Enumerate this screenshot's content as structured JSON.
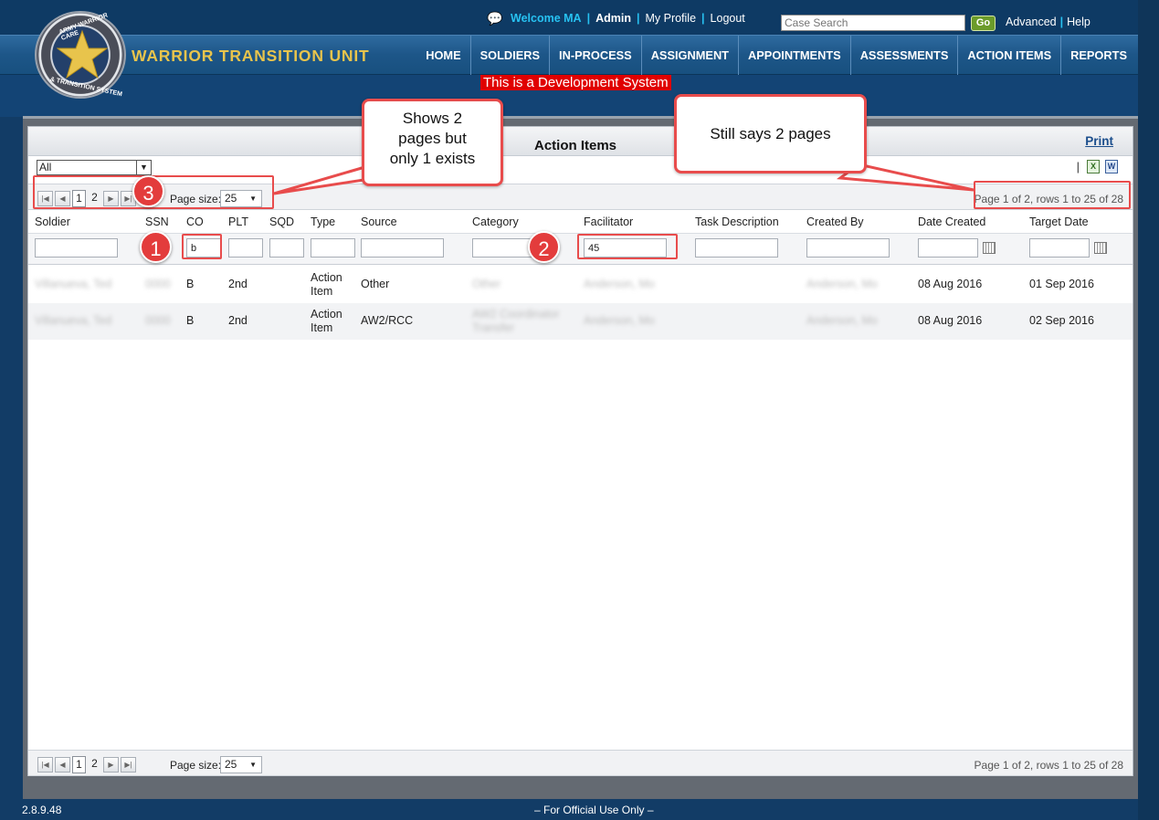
{
  "header": {
    "welcome": "Welcome MA",
    "admin": "Admin",
    "my_profile": "My Profile",
    "logout": "Logout",
    "case_search_placeholder": "Case Search",
    "go": "Go",
    "advanced": "Advanced",
    "help": "Help",
    "brand": "WARRIOR TRANSITION UNIT",
    "logo_text_top": "ARMY WARRIOR CARE",
    "logo_text_bottom": "& TRANSITION SYSTEM"
  },
  "nav": [
    "HOME",
    "SOLDIERS",
    "IN-PROCESS",
    "ASSIGNMENT",
    "APPOINTMENTS",
    "ASSESSMENTS",
    "ACTION ITEMS",
    "REPORTS"
  ],
  "dev_banner": "This is a Development System",
  "page": {
    "title": "Action Items",
    "print": "Print",
    "filter_value": "All"
  },
  "pager": {
    "pages": [
      "1",
      "2"
    ],
    "page_size_label": "Page size:",
    "page_size": "25",
    "info": "Page 1 of 2, rows 1 to 25 of 28"
  },
  "columns": [
    "Soldier",
    "SSN",
    "CO",
    "PLT",
    "SQD",
    "Type",
    "Source",
    "Category",
    "Facilitator",
    "Task Description",
    "Created By",
    "Date Created",
    "Target Date"
  ],
  "filters": {
    "co": "b",
    "facilitator": "45"
  },
  "rows": [
    {
      "soldier": "Villanueva, Ted",
      "ssn": "0000",
      "co": "B",
      "plt": "2nd",
      "sqd": "",
      "type_line1": "Action",
      "type_line2": "Item",
      "source": "Other",
      "category_line1": "Other",
      "category_line2": "",
      "facilitator": "Anderson, Mo",
      "task": "",
      "created_by": "Anderson, Mo",
      "date_created": "08 Aug 2016",
      "target_date": "01 Sep 2016"
    },
    {
      "soldier": "Villanueva, Ted",
      "ssn": "0000",
      "co": "B",
      "plt": "2nd",
      "sqd": "",
      "type_line1": "Action",
      "type_line2": "Item",
      "source": "AW2/RCC",
      "category_line1": "AW2 Coordinator",
      "category_line2": "Transfer",
      "facilitator": "Anderson, Mo",
      "task": "",
      "created_by": "Anderson, Mo",
      "date_created": "08 Aug 2016",
      "target_date": "02 Sep 2016"
    }
  ],
  "annotations": {
    "callout_left": [
      "Shows 2",
      "pages but",
      "only 1 exists"
    ],
    "callout_right": "Still says 2 pages",
    "badge1": "1",
    "badge2": "2",
    "badge3": "3"
  },
  "footer": {
    "version": "2.8.9.48",
    "notice": "– For Official Use Only –"
  },
  "colors": {
    "accent_red": "#e84c4c",
    "nav_blue": "#1d5688",
    "brand_gold": "#e8c44c",
    "welcome_cyan": "#27c2f2"
  }
}
